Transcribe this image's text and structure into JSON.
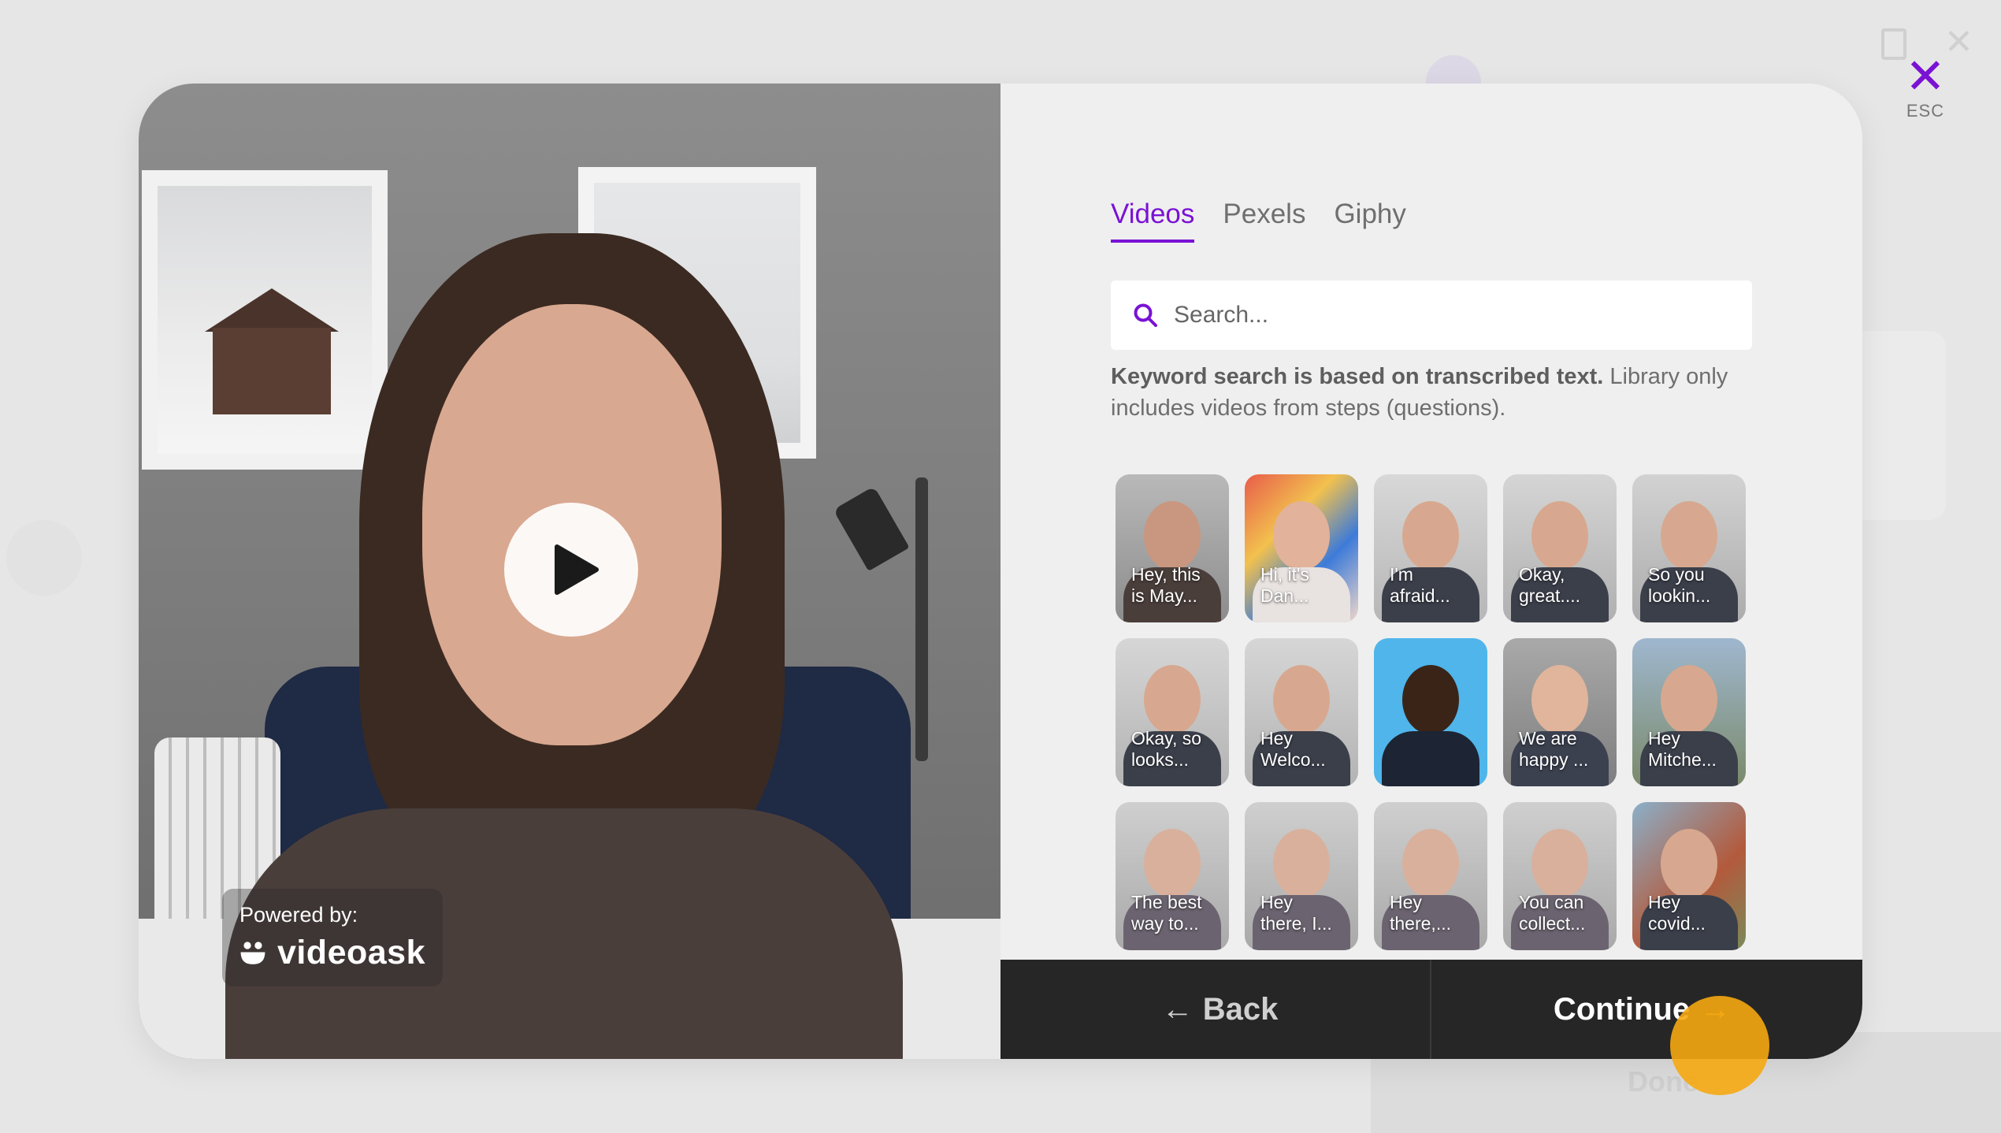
{
  "modal": {
    "close_label": "ESC",
    "accent_color": "#7a12d4"
  },
  "video_preview": {
    "powered_by_label": "Powered by:",
    "brand_name": "videoask"
  },
  "library": {
    "tabs": [
      {
        "label": "Videos",
        "active": true
      },
      {
        "label": "Pexels",
        "active": false
      },
      {
        "label": "Giphy",
        "active": false
      }
    ],
    "search": {
      "placeholder": "Search..."
    },
    "hint_bold": "Keyword search is based on transcribed text.",
    "hint_rest": " Library only includes videos from steps (questions).",
    "videos": [
      {
        "caption_line1": "Hey, this",
        "caption_line2": "is May..."
      },
      {
        "caption_line1": "Hi, it's",
        "caption_line2": "Dan..."
      },
      {
        "caption_line1": "I'm",
        "caption_line2": "afraid..."
      },
      {
        "caption_line1": "Okay,",
        "caption_line2": "great...."
      },
      {
        "caption_line1": "So you",
        "caption_line2": "lookin..."
      },
      {
        "caption_line1": "Okay, so",
        "caption_line2": "looks..."
      },
      {
        "caption_line1": "Hey",
        "caption_line2": "Welco..."
      },
      {
        "caption_line1": "",
        "caption_line2": ""
      },
      {
        "caption_line1": "We are",
        "caption_line2": "happy ..."
      },
      {
        "caption_line1": "Hey",
        "caption_line2": "Mitche..."
      },
      {
        "caption_line1": "The best",
        "caption_line2": "way to..."
      },
      {
        "caption_line1": "Hey",
        "caption_line2": "there, I..."
      },
      {
        "caption_line1": "Hey",
        "caption_line2": "there,..."
      },
      {
        "caption_line1": "You can",
        "caption_line2": "collect..."
      },
      {
        "caption_line1": "Hey",
        "caption_line2": "covid..."
      }
    ]
  },
  "footer": {
    "back_label": "Back",
    "continue_label": "Continue"
  },
  "background": {
    "done_label": "Done"
  }
}
